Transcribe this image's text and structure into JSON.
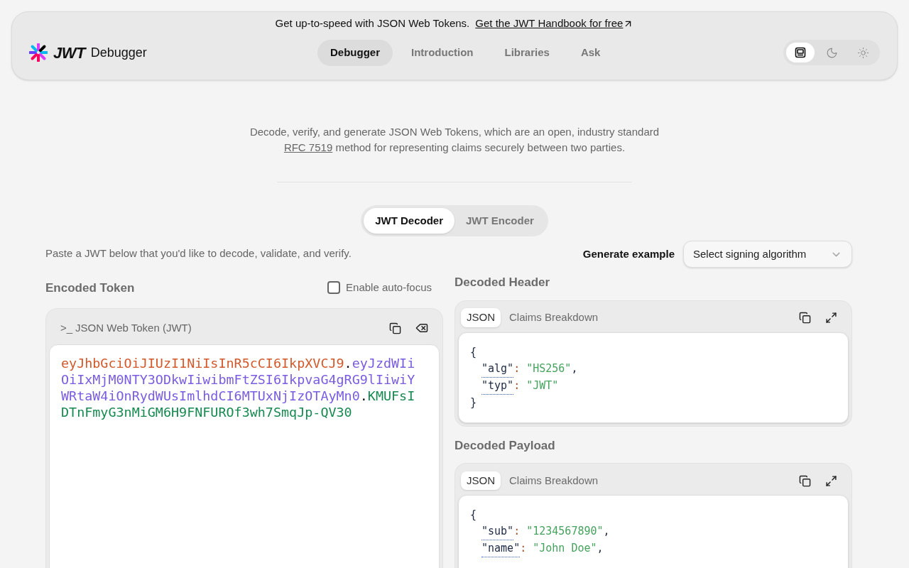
{
  "banner": {
    "text": "Get up-to-speed with JSON Web Tokens.",
    "link": "Get the JWT Handbook for free"
  },
  "brand": {
    "logo": "JWT",
    "name": "Debugger"
  },
  "nav": [
    {
      "label": "Debugger",
      "selected": true
    },
    {
      "label": "Introduction",
      "selected": false
    },
    {
      "label": "Libraries",
      "selected": false
    },
    {
      "label": "Ask",
      "selected": false
    }
  ],
  "theme": [
    {
      "kind": "system",
      "selected": true
    },
    {
      "kind": "dark",
      "selected": false
    },
    {
      "kind": "light",
      "selected": false
    }
  ],
  "intro": {
    "before": "Decode, verify, and generate JSON Web Tokens, which are an open, industry standard",
    "link": "RFC 7519",
    "after": "method for representing claims securely between two parties."
  },
  "modes": [
    {
      "label": "JWT Decoder",
      "selected": true
    },
    {
      "label": "JWT Encoder",
      "selected": false
    }
  ],
  "hint": "Paste a JWT below that you'd like to decode, validate, and verify.",
  "generate": {
    "label": "Generate example",
    "placeholder": "Select signing algorithm"
  },
  "encoded": {
    "title": "Encoded Token",
    "autofocus": {
      "label": "Enable auto-focus",
      "checked": false
    },
    "panel_prompt": ">_",
    "panel_title": "JSON Web Token (JWT)",
    "segments": [
      {
        "kind": "header",
        "text": "eyJhbGciOiJIUzI1NiIsInR5cCI6IkpXVCJ9"
      },
      {
        "kind": "dot",
        "text": "."
      },
      {
        "kind": "payload",
        "text": "eyJzdWIiOiIxMjM0NTY3ODkwIiwibmFtZSI6IkpvaG4gRG9lIiwiYWRtaW4iOnRydWUsImlhdCI6MTUxNjIzOTAyMn0"
      },
      {
        "kind": "dot",
        "text": "."
      },
      {
        "kind": "signature",
        "text": "KMUFsIDTnFmyG3nMiGM6H9FNFUROf3wh7SmqJp-QV30"
      }
    ]
  },
  "decoded": [
    {
      "title": "Decoded Header",
      "tabs": [
        {
          "label": "JSON",
          "selected": true
        },
        {
          "label": "Claims Breakdown",
          "selected": false
        }
      ],
      "lines": [
        {
          "kind": "brace",
          "text": "{"
        },
        {
          "kind": "pair",
          "key": "\"alg\"",
          "colon": ":",
          "value": "\"HS256\"",
          "comma": ","
        },
        {
          "kind": "pair",
          "key": "\"typ\"",
          "colon": ":",
          "value": "\"JWT\""
        },
        {
          "kind": "brace",
          "text": "}"
        }
      ]
    },
    {
      "title": "Decoded Payload",
      "tabs": [
        {
          "label": "JSON",
          "selected": true
        },
        {
          "label": "Claims Breakdown",
          "selected": false
        }
      ],
      "lines": [
        {
          "kind": "brace",
          "text": "{"
        },
        {
          "kind": "pair",
          "key": "\"sub\"",
          "colon": ":",
          "value": "\"1234567890\"",
          "comma": ","
        },
        {
          "kind": "pair",
          "key": "\"name\"",
          "colon": ":",
          "value": "\"John Doe\"",
          "comma": ","
        }
      ]
    }
  ]
}
